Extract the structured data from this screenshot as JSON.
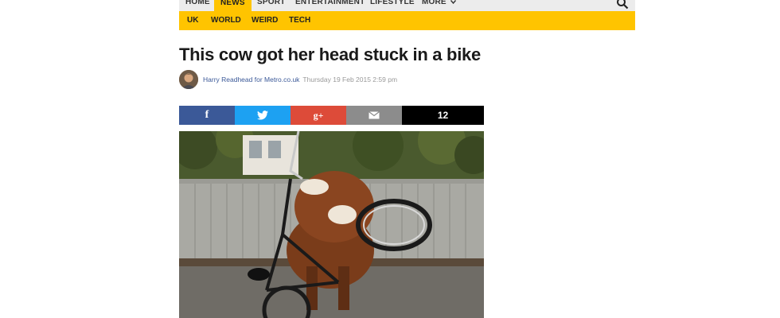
{
  "top_nav": {
    "items": [
      "HOME",
      "NEWS",
      "SPORT",
      "ENTERTAINMENT",
      "LIFESTYLE",
      "MORE"
    ],
    "active": "NEWS"
  },
  "sub_nav": {
    "items": [
      "UK",
      "WORLD",
      "WEIRD",
      "TECH"
    ]
  },
  "article": {
    "headline": "This cow got her head stuck in a bike",
    "author": "Harry Readhead for Metro.co.uk",
    "date": "Thursday 19 Feb 2015 2:59 pm"
  },
  "share_bar": {
    "facebook_icon": "f",
    "google_icon": "g+",
    "share_count": "12"
  },
  "icons": {
    "search": "search-icon",
    "facebook": "facebook-icon",
    "twitter": "twitter-icon",
    "google_plus": "google-plus-icon",
    "email": "email-icon",
    "more_chevron": "chevron-down-icon"
  },
  "colors": {
    "brand_yellow": "#ffc400",
    "facebook": "#3b5998",
    "twitter": "#1da1f2",
    "google_plus": "#dd4b39",
    "email": "#8c8c8c",
    "count": "#000000"
  }
}
